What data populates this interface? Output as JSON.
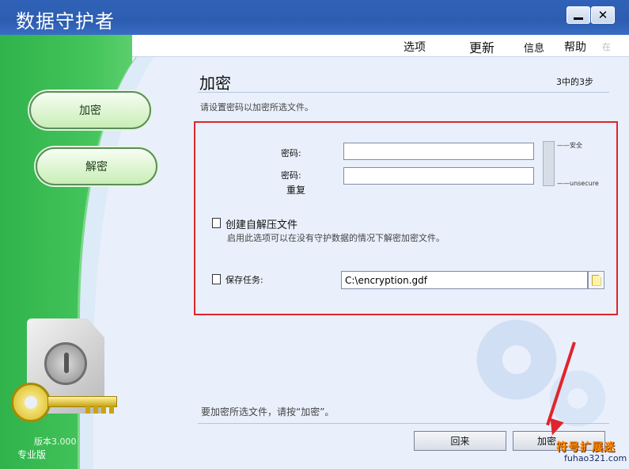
{
  "window": {
    "title": "数据守护者",
    "minimize_label": "",
    "close_label": "✕"
  },
  "menu": {
    "options": "选项",
    "update": "更新",
    "info": "信息",
    "help": "帮助",
    "extra": "在"
  },
  "sidebar": {
    "encrypt": "加密",
    "decrypt": "解密",
    "version": "版本3.000",
    "edition": "专业版"
  },
  "main": {
    "title": "加密",
    "step": "3中的3步",
    "subtitle": "请设置密码以加密所选文件。",
    "password_label": "密码:",
    "password_repeat_label": "密码:",
    "password_repeat_label2": "重复",
    "password_value": "",
    "password_repeat_value": "",
    "strength_safe": "——安全",
    "strength_unsafe": "——unsecure",
    "sfx_label": "创建自解压文件",
    "sfx_desc": "启用此选项可以在没有守护数据的情况下解密加密文件。",
    "save_label": "保存任务:",
    "save_path": "C:\\encryption.gdf",
    "hint": "要加密所选文件，请按“加密”。",
    "back_button": "回来",
    "encrypt_button": "加密"
  },
  "watermark": {
    "text": "符号扩展迷",
    "url": "fuhao321.com"
  },
  "colors": {
    "title_bar": "#2f62b6",
    "sidebar_green": "#45c45c",
    "highlight_box": "#e0242d"
  }
}
